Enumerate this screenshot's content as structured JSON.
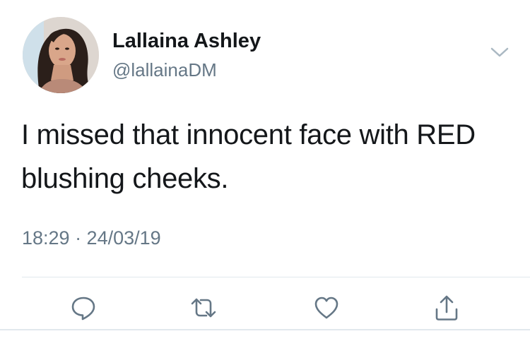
{
  "user": {
    "display_name": "Lallaina Ashley",
    "handle": "@lallainaDM",
    "avatar_icon": "profile-photo"
  },
  "tweet": {
    "text": "I missed that innocent face with RED blushing cheeks.",
    "timestamp": "18:29 · 24/03/19"
  },
  "actions": [
    {
      "name": "reply",
      "icon": "reply-icon"
    },
    {
      "name": "retweet",
      "icon": "retweet-icon"
    },
    {
      "name": "like",
      "icon": "like-icon"
    },
    {
      "name": "share",
      "icon": "share-icon"
    }
  ],
  "colors": {
    "text_primary": "#14171a",
    "text_secondary": "#657786",
    "divider": "#e1e8ed",
    "icon": "#657786"
  }
}
